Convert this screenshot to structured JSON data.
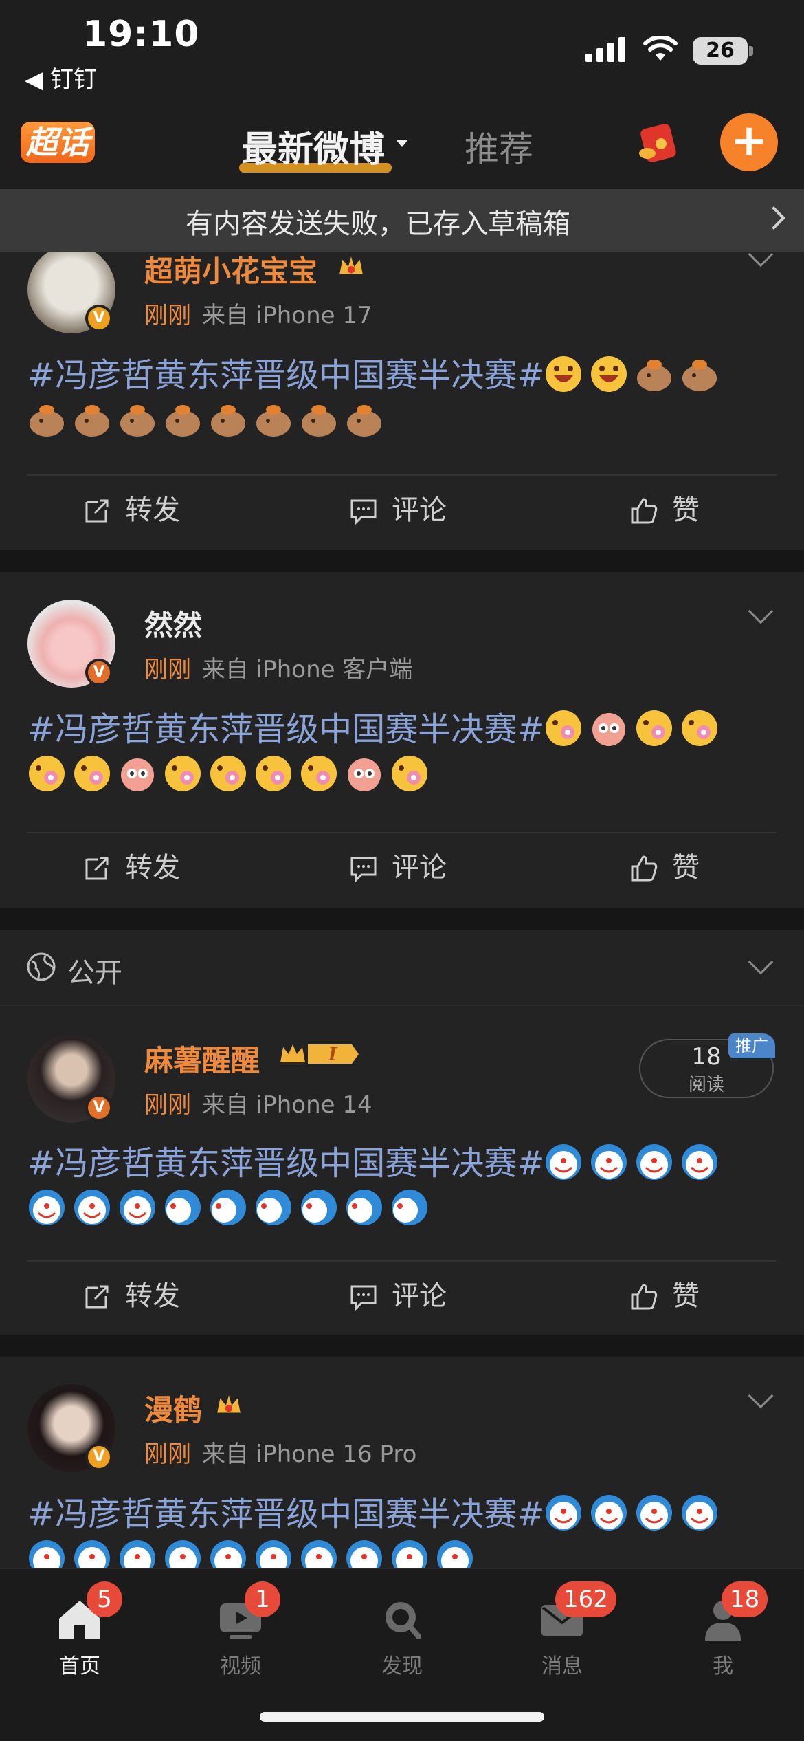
{
  "status_bar": {
    "time": "19:10",
    "back_app": "◀ 钉钉",
    "battery": "26"
  },
  "nav": {
    "chaohua": "超话",
    "tab_latest": "最新微博",
    "tab_recommend": "推荐"
  },
  "banner": {
    "text": "有内容发送失败，已存入草稿箱"
  },
  "posts": [
    {
      "name": "超萌小花宝宝",
      "time": "刚刚",
      "source": "来自 iPhone 17",
      "topic": "#冯彦哲黄东萍晋级中国赛半决赛#"
    },
    {
      "name": "然然",
      "time": "刚刚",
      "source": "来自 iPhone 客户端",
      "topic": "#冯彦哲黄东萍晋级中国赛半决赛#"
    },
    {
      "name": "麻薯醒醒",
      "time": "刚刚",
      "source": "来自 iPhone 14",
      "topic": "#冯彦哲黄东萍晋级中国赛半决赛#",
      "read_count": "18",
      "read_label": "阅读",
      "promo": "推广"
    },
    {
      "name": "漫鹤",
      "time": "刚刚",
      "source": "来自 iPhone 16 Pro",
      "topic": "#冯彦哲黄东萍晋级中国赛半决赛#"
    }
  ],
  "public_label": "公开",
  "actions": {
    "repost": "转发",
    "comment": "评论",
    "like": "赞"
  },
  "tabbar": [
    {
      "label": "首页",
      "badge": "5"
    },
    {
      "label": "视频",
      "badge": "1"
    },
    {
      "label": "发现",
      "badge": ""
    },
    {
      "label": "消息",
      "badge": "162"
    },
    {
      "label": "我",
      "badge": "18"
    }
  ],
  "colors": {
    "accent": "#f6822a",
    "topic": "#8aa3d8",
    "badge": "#e84a3a",
    "background": "#1e1e1e"
  }
}
